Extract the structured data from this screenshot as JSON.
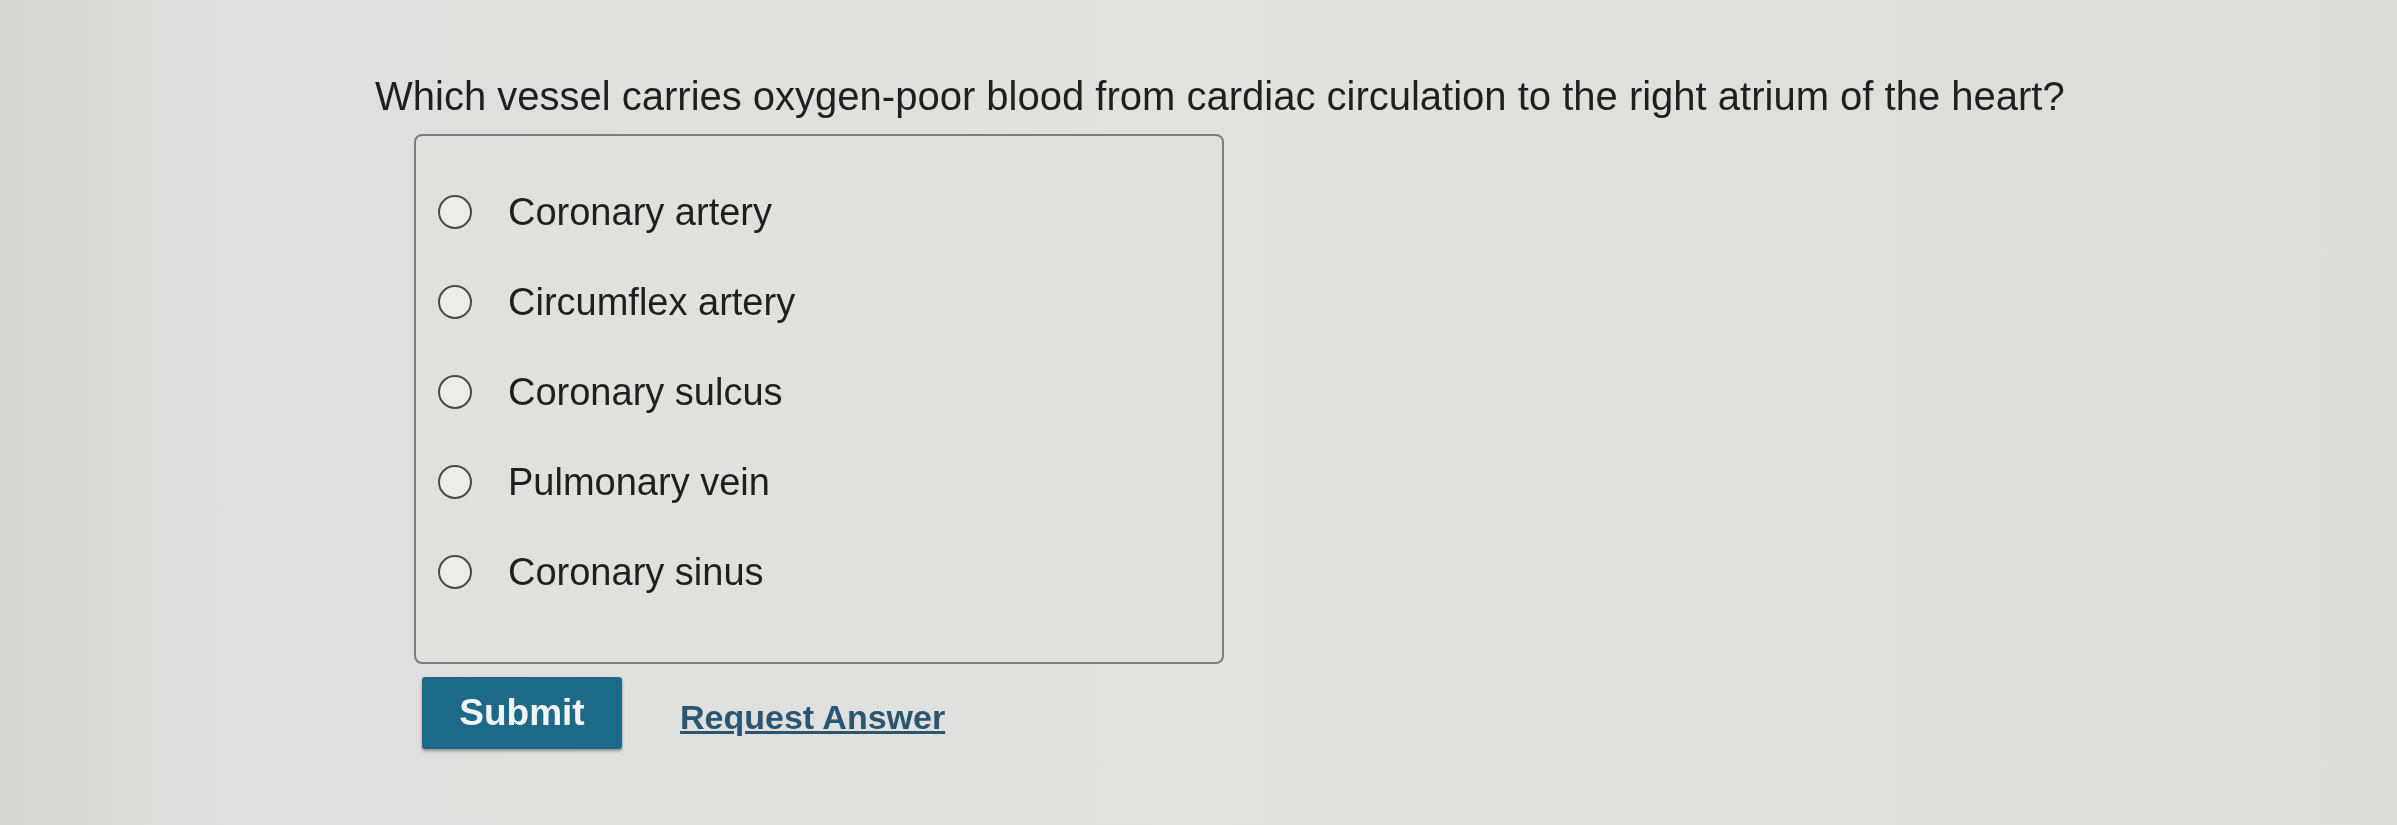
{
  "question": {
    "text": "Which vessel carries oxygen-poor blood from cardiac circulation to the right atrium of the heart?"
  },
  "options": [
    {
      "label": "Coronary artery",
      "selected": false
    },
    {
      "label": "Circumflex artery",
      "selected": false
    },
    {
      "label": "Coronary sulcus",
      "selected": false
    },
    {
      "label": "Pulmonary vein",
      "selected": false
    },
    {
      "label": "Coronary sinus",
      "selected": false
    }
  ],
  "actions": [
    {
      "kind": "button",
      "label": "Submit"
    },
    {
      "kind": "link",
      "label": "Request Answer"
    }
  ]
}
